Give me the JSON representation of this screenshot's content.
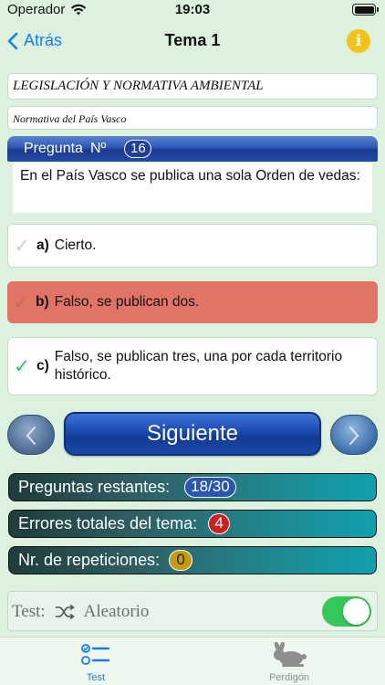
{
  "status": {
    "carrier": "Operador",
    "time": "19:03"
  },
  "nav": {
    "back_label": "Atrás",
    "title": "Tema 1",
    "info_label": "i"
  },
  "law_title": "LEGISLACIÓN Y NORMATIVA AMBIENTAL",
  "law_subtitle": "Normativa del País Vasco",
  "question": {
    "header_label": "Pregunta",
    "number_symbol": "Nº",
    "number": "16",
    "text": "En el País Vasco se publica una sola Orden de vedas:"
  },
  "answers": [
    {
      "letter": "a)",
      "text": "Cierto.",
      "state": "neutral"
    },
    {
      "letter": "b)",
      "text": "Falso, se publican dos.",
      "state": "wrong"
    },
    {
      "letter": "c)",
      "text": "Falso, se publican tres, una por cada territorio histórico.",
      "state": "correct"
    }
  ],
  "controls": {
    "next_label": "Siguiente",
    "prev_icon": "chevron-left-icon",
    "next_icon": "chevron-right-icon"
  },
  "stats": {
    "remaining_label": "Preguntas restantes:",
    "remaining_value": "18/30",
    "errors_label": "Errores totales del tema:",
    "errors_value": "4",
    "repeats_label": "Nr. de repeticiones:",
    "repeats_value": "0"
  },
  "test_mode": {
    "label": "Test:",
    "mode": "Aleatorio",
    "enabled": true
  },
  "tabs": [
    {
      "label": "Test",
      "icon": "list-checklist-icon",
      "active": true
    },
    {
      "label": "Perdigón",
      "icon": "rabbit-icon",
      "active": false
    }
  ],
  "colors": {
    "accent": "#1a7cf5",
    "background": "#dcf2de",
    "wrong": "#e07465",
    "correct": "#2ec25f",
    "toggle_on": "#34c759"
  }
}
